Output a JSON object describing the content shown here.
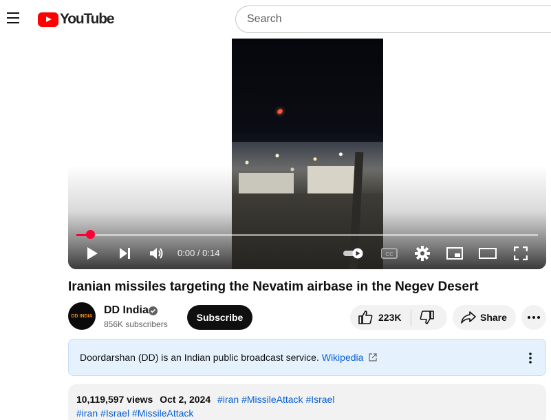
{
  "header": {
    "logo_text": "YouTube",
    "search_placeholder": "Search"
  },
  "player": {
    "time_display": "0:00 / 0:14",
    "progress_fraction": 0.03
  },
  "video": {
    "title": "Iranian missiles targeting the Nevatim airbase in the Negev Desert"
  },
  "channel": {
    "name": "DD India",
    "avatar_text": "DD INDIA",
    "subscribers": "856K subscribers",
    "subscribe_label": "Subscribe"
  },
  "actions": {
    "like_count": "223K",
    "share_label": "Share"
  },
  "info_panel": {
    "text": "Doordarshan (DD) is an Indian public broadcast service.",
    "link_text": "Wikipedia"
  },
  "description": {
    "views": "10,119,597 views",
    "date": "Oct 2, 2024",
    "hashtags_line1": [
      "#iran",
      "#MissileAttack",
      "#Israel"
    ],
    "hashtags_line2": [
      "#iran",
      "#Israel",
      "#MissileAttack"
    ]
  },
  "icons": {
    "menu": "hamburger-icon",
    "play": "play-icon",
    "next": "next-icon",
    "volume": "volume-icon",
    "autoplay": "autoplay-toggle-icon",
    "captions": "cc-icon",
    "settings": "gear-icon",
    "miniplayer": "miniplayer-icon",
    "theater": "theater-icon",
    "fullscreen": "fullscreen-icon",
    "like": "thumbs-up-icon",
    "dislike": "thumbs-down-icon",
    "share": "share-arrow-icon",
    "more": "more-horizontal-icon",
    "info_more": "more-vertical-icon",
    "external": "external-link-icon"
  },
  "colors": {
    "brand_red": "#ff0000",
    "progress_red": "#ff0033",
    "link_blue": "#065fd4",
    "info_panel_bg": "#e5f1fc"
  }
}
